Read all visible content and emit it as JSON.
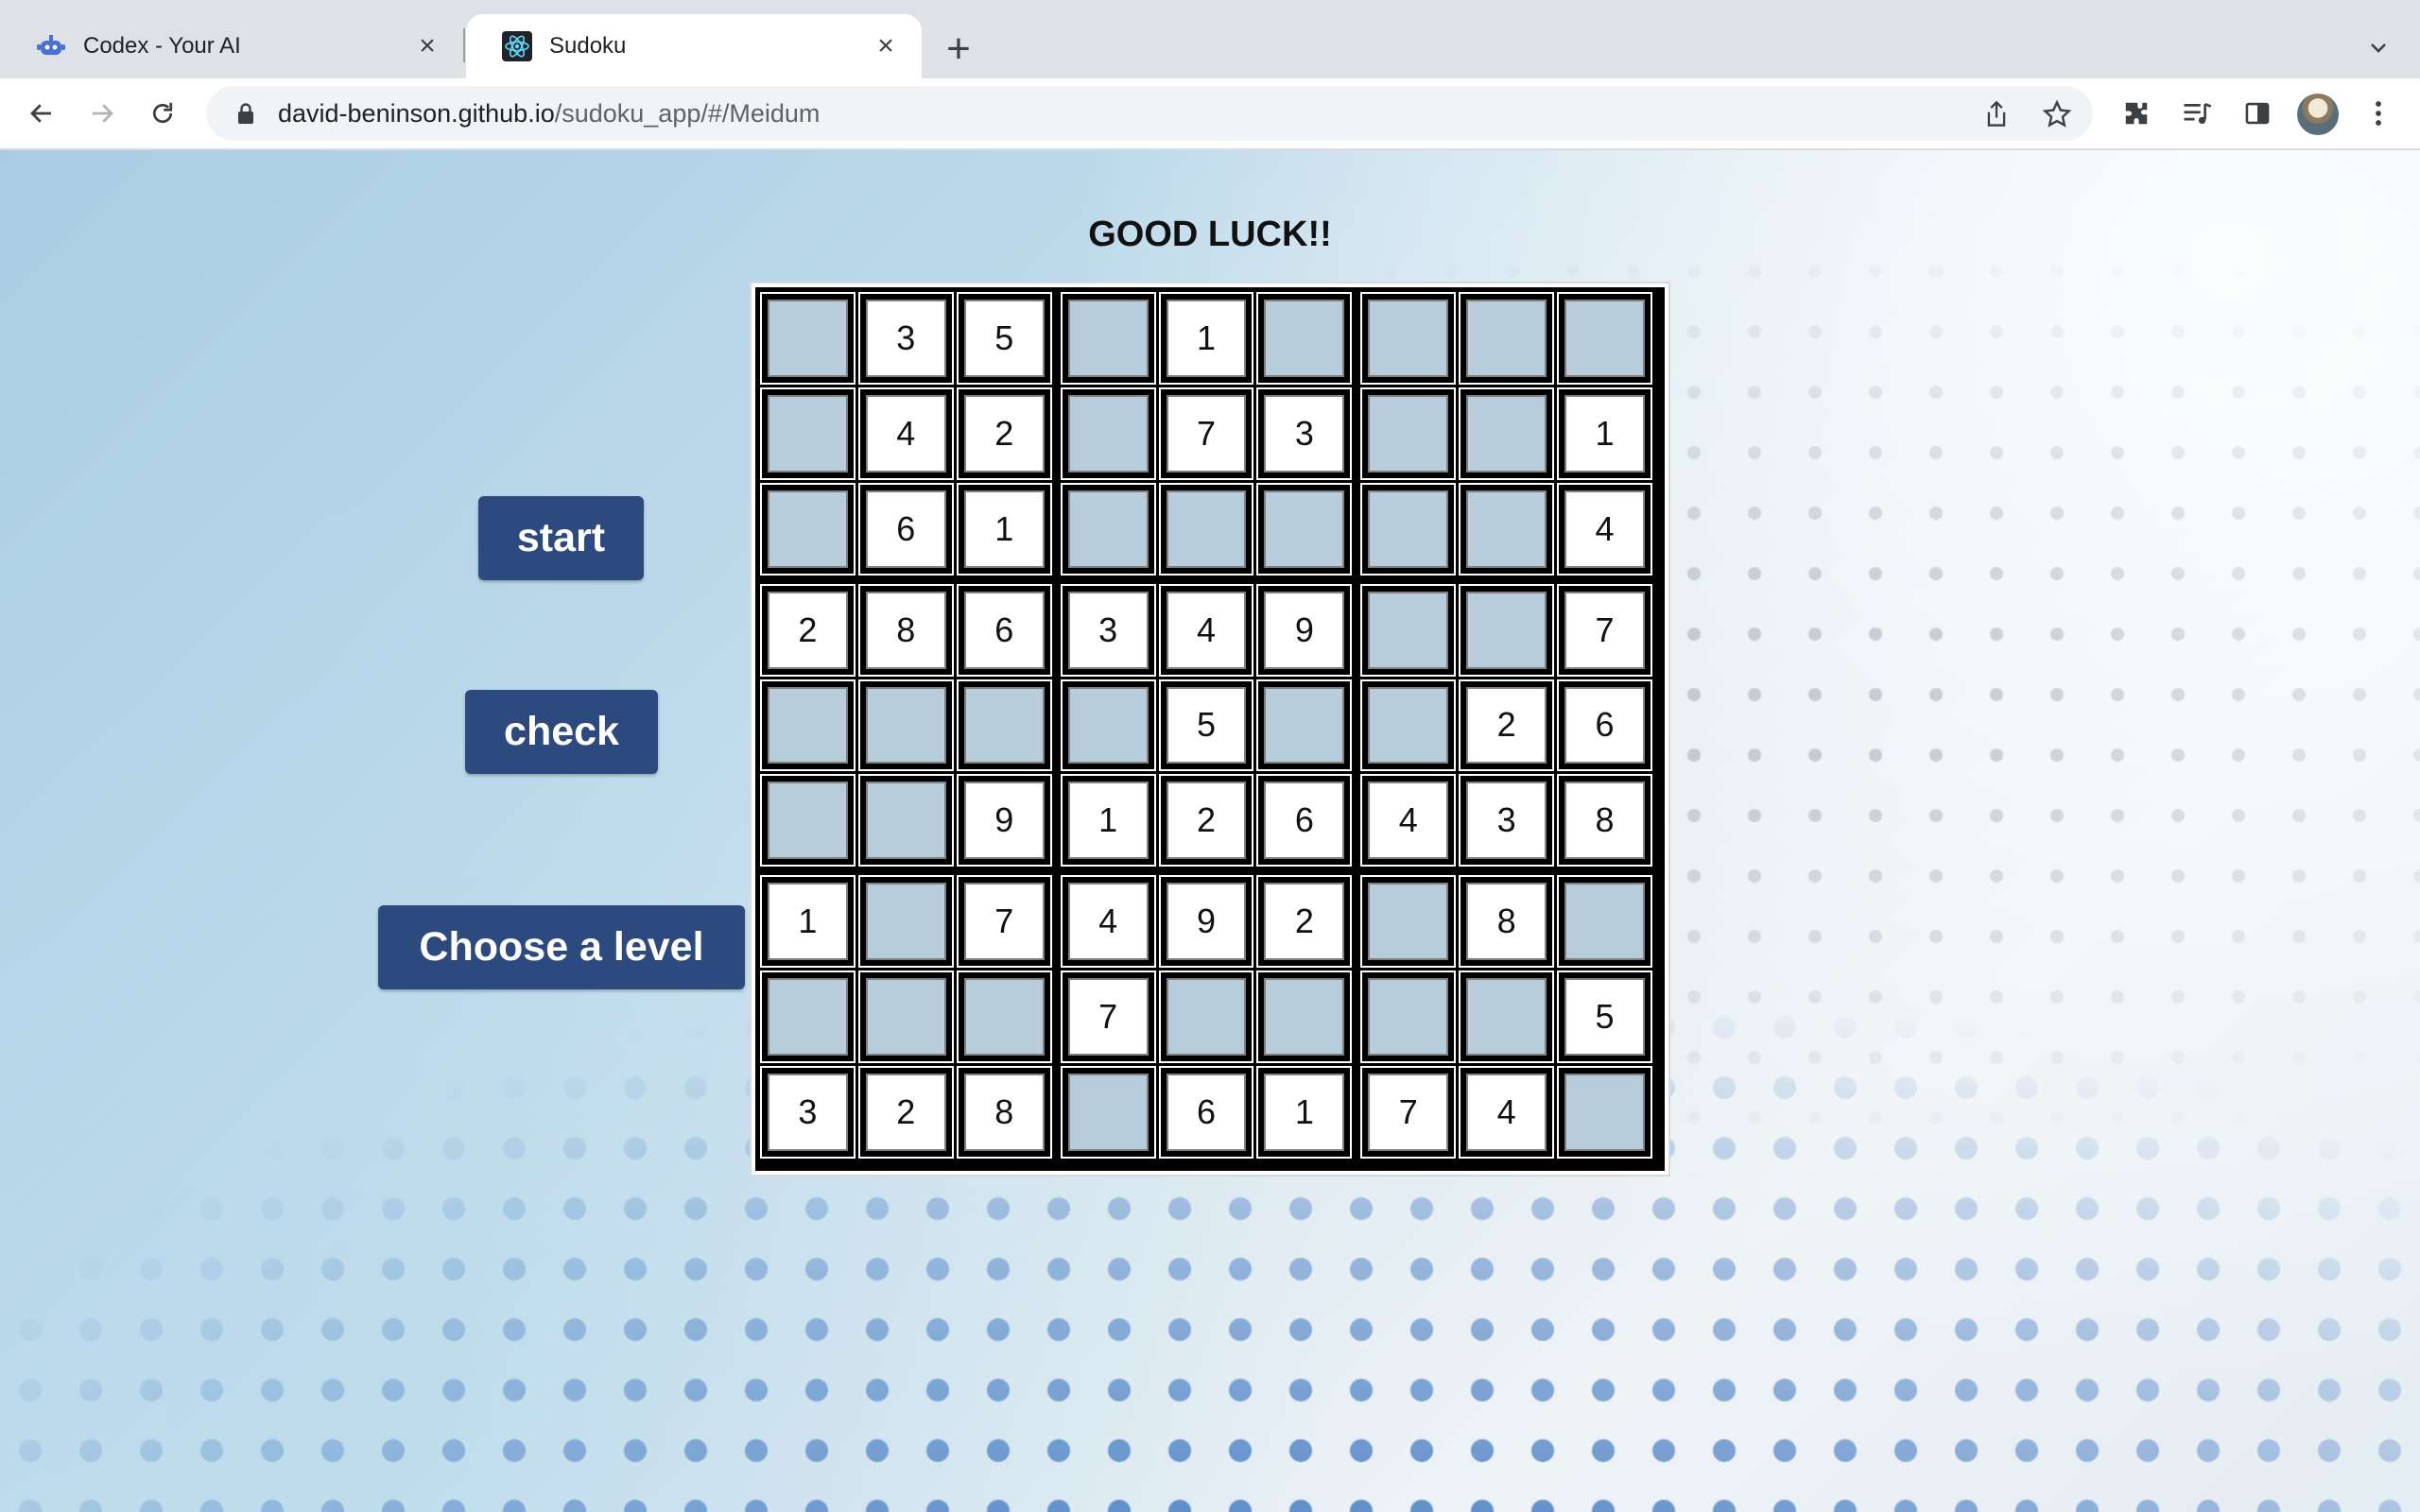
{
  "browser": {
    "tabs": [
      {
        "title": "Codex - Your AI",
        "favicon": "robot-icon",
        "active": false
      },
      {
        "title": "Sudoku",
        "favicon": "react-icon",
        "active": true
      }
    ],
    "url_host": "david-beninson.github.io",
    "url_path": "/sudoku_app/#/Meidum"
  },
  "page": {
    "heading": "GOOD LUCK!!",
    "buttons": {
      "start": "start",
      "check": "check",
      "level": "Choose a level"
    }
  },
  "colors": {
    "button": "#2c4a7e",
    "empty_cell": "#b7cddc",
    "given_cell": "#ffffff"
  },
  "grid": [
    [
      "",
      "3",
      "5",
      "",
      "1",
      "",
      "",
      "",
      ""
    ],
    [
      "",
      "4",
      "2",
      "",
      "7",
      "3",
      "",
      "",
      "1"
    ],
    [
      "",
      "6",
      "1",
      "",
      "",
      "",
      "",
      "",
      "4"
    ],
    [
      "2",
      "8",
      "6",
      "3",
      "4",
      "9",
      "",
      "",
      "7"
    ],
    [
      "",
      "",
      "",
      "",
      "5",
      "",
      "",
      "2",
      "6"
    ],
    [
      "",
      "",
      "9",
      "1",
      "2",
      "6",
      "4",
      "3",
      "8"
    ],
    [
      "1",
      "",
      "7",
      "4",
      "9",
      "2",
      "",
      "8",
      ""
    ],
    [
      "",
      "",
      "",
      "7",
      "",
      "",
      "",
      "",
      "5"
    ],
    [
      "3",
      "2",
      "8",
      "",
      "6",
      "1",
      "7",
      "4",
      ""
    ]
  ]
}
